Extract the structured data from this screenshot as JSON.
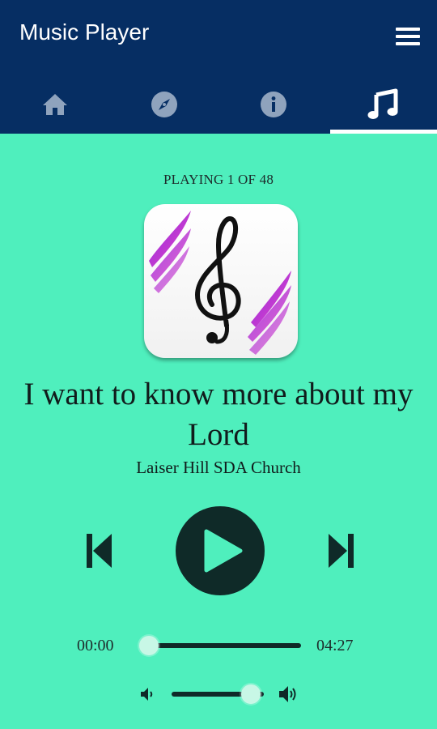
{
  "app": {
    "title": "Music Player"
  },
  "header": {
    "menu_icon": "hamburger-menu-icon"
  },
  "tabs": [
    {
      "name": "home",
      "icon": "home-icon",
      "active": false
    },
    {
      "name": "explore",
      "icon": "compass-icon",
      "active": false
    },
    {
      "name": "info",
      "icon": "info-icon",
      "active": false
    },
    {
      "name": "music",
      "icon": "music-note-icon",
      "active": true
    }
  ],
  "player": {
    "queue_status": "PLAYING 1 OF 48",
    "song_title": "I want to know more about my Lord",
    "artist": "Laiser Hill SDA Church",
    "artwork_icon": "treble-clef-icon",
    "current_time": "00:00",
    "duration": "04:27",
    "progress": 0.0,
    "volume": 0.86
  },
  "colors": {
    "appbar": "#062e63",
    "background": "#4fefbd",
    "tab_inactive": "#8fa3bd",
    "tab_active": "#ffffff",
    "controls": "#0f2a28",
    "thumb": "#c8f7e6",
    "artwork_accent": "#b53bd6"
  }
}
